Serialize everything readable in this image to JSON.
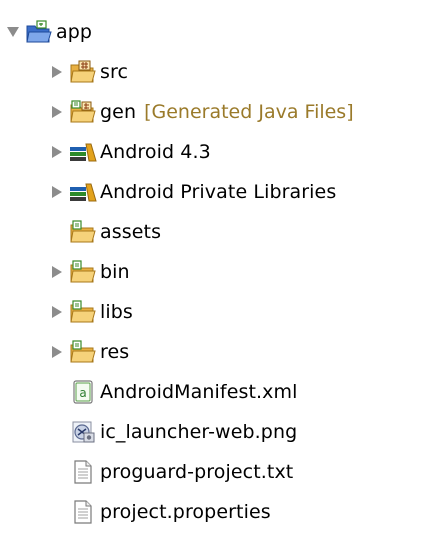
{
  "tree": {
    "root": {
      "label": "app",
      "expanded": true,
      "icon": "project-folder-icon"
    },
    "items": [
      {
        "label": "src",
        "icon": "source-package-folder-icon",
        "expandable": true
      },
      {
        "label": "gen",
        "decoration": "[Generated Java Files]",
        "icon": "generated-source-folder-icon",
        "expandable": true
      },
      {
        "label": "Android 4.3",
        "icon": "library-container-icon",
        "expandable": true
      },
      {
        "label": "Android Private Libraries",
        "icon": "library-container-icon",
        "expandable": true
      },
      {
        "label": "assets",
        "icon": "folder-icon",
        "expandable": false
      },
      {
        "label": "bin",
        "icon": "folder-icon",
        "expandable": true
      },
      {
        "label": "libs",
        "icon": "folder-icon",
        "expandable": true
      },
      {
        "label": "res",
        "icon": "folder-icon",
        "expandable": true
      },
      {
        "label": "AndroidManifest.xml",
        "icon": "xml-file-icon",
        "expandable": false
      },
      {
        "label": "ic_launcher-web.png",
        "icon": "image-file-icon",
        "expandable": false
      },
      {
        "label": "proguard-project.txt",
        "icon": "text-file-icon",
        "expandable": false
      },
      {
        "label": "project.properties",
        "icon": "text-file-icon",
        "expandable": false
      }
    ]
  },
  "colors": {
    "arrow": "#8c8c8c",
    "folder": "#f2c35a",
    "folder_dark": "#b8862a",
    "decoration": "#9a7a2a"
  }
}
